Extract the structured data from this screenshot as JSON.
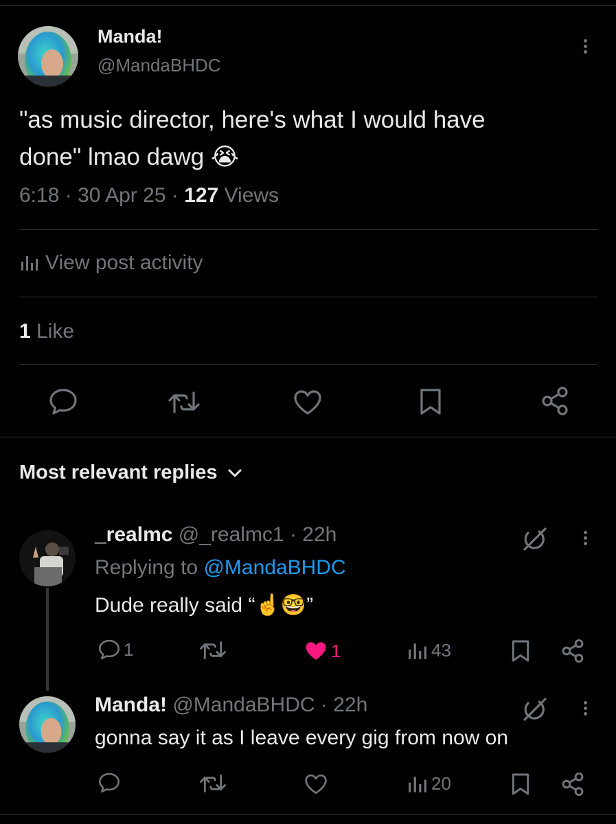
{
  "main_post": {
    "display_name": "Manda!",
    "handle": "@MandaBHDC",
    "text_line1": "\"as music director, here's what I would have",
    "text_line2": "done\" lmao dawg",
    "emoji": "😭",
    "time": "6:18",
    "date": "30 Apr 25",
    "views_count": "127",
    "views_label": "Views",
    "activity_label": "View post activity",
    "likes_count": "1",
    "likes_label": "Like"
  },
  "replies_header": {
    "label": "Most relevant replies"
  },
  "replies": [
    {
      "display_name": "_realmc",
      "handle": "@_realmc1",
      "age": "22h",
      "replying_prefix": "Replying to",
      "replying_handle": "@MandaBHDC",
      "text_prefix": "Dude really said “",
      "text_emoji": "☝️🤓",
      "text_suffix": "”",
      "reply_count": "1",
      "like_count": "1",
      "view_count": "43"
    },
    {
      "display_name": "Manda!",
      "handle": "@MandaBHDC",
      "age": "22h",
      "text": "gonna say it as I leave every gig from now on",
      "view_count": "20"
    }
  ],
  "colors": {
    "background": "#000000",
    "text": "#e7e9ea",
    "muted": "#71767b",
    "link": "#1d9bf0",
    "like": "#f91880",
    "divider": "#2f3336"
  },
  "icons": [
    "more-icon",
    "stats-icon",
    "reply-icon",
    "retweet-icon",
    "like-icon",
    "bookmark-icon",
    "share-icon",
    "chevron-down-icon",
    "grok-icon"
  ]
}
